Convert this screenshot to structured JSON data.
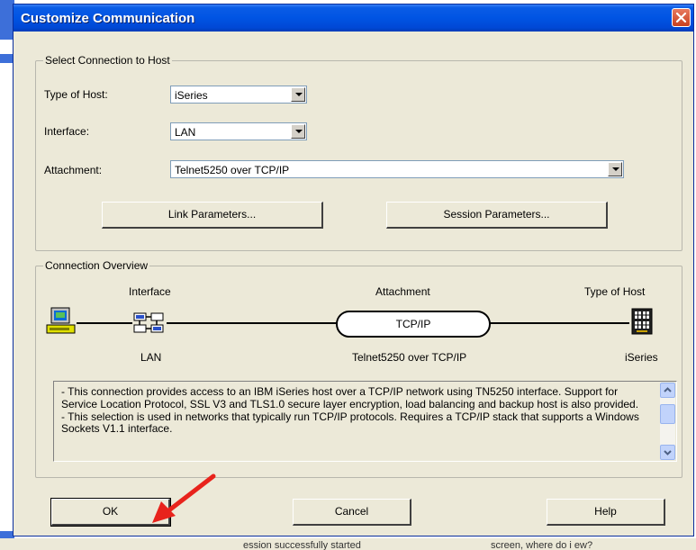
{
  "window": {
    "title": "Customize Communication"
  },
  "select_group": {
    "legend": "Select Connection to Host",
    "type_of_host_label": "Type of Host:",
    "type_of_host_value": "iSeries",
    "interface_label": "Interface:",
    "interface_value": "LAN",
    "attachment_label": "Attachment:",
    "attachment_value": "Telnet5250 over TCP/IP",
    "link_params_label": "Link Parameters...",
    "session_params_label": "Session Parameters..."
  },
  "overview_group": {
    "legend": "Connection Overview",
    "interface_heading": "Interface",
    "attachment_heading": "Attachment",
    "host_heading": "Type of Host",
    "protocol": "TCP/IP",
    "interface_value": "LAN",
    "attachment_value": "Telnet5250 over TCP/IP",
    "host_value": "iSeries",
    "description": "- This connection provides access to an IBM iSeries host over  a TCP/IP network using TN5250 interface.  Support for Service Location Protocol, SSL V3 and TLS1.0 secure layer encryption, load balancing and backup host is also provided.\n- This selection is used in networks that typically run TCP/IP protocols. Requires a TCP/IP  stack that supports a Windows Sockets V1.1 interface."
  },
  "buttons": {
    "ok": "OK",
    "cancel": "Cancel",
    "help": "Help"
  },
  "background": {
    "left_text": "ession successfully started",
    "right_text": "screen, where do i ew?"
  },
  "colors": {
    "titlebar": "#0054e3",
    "dialog_bg": "#ece9d8",
    "arrow": "#e8231c"
  }
}
